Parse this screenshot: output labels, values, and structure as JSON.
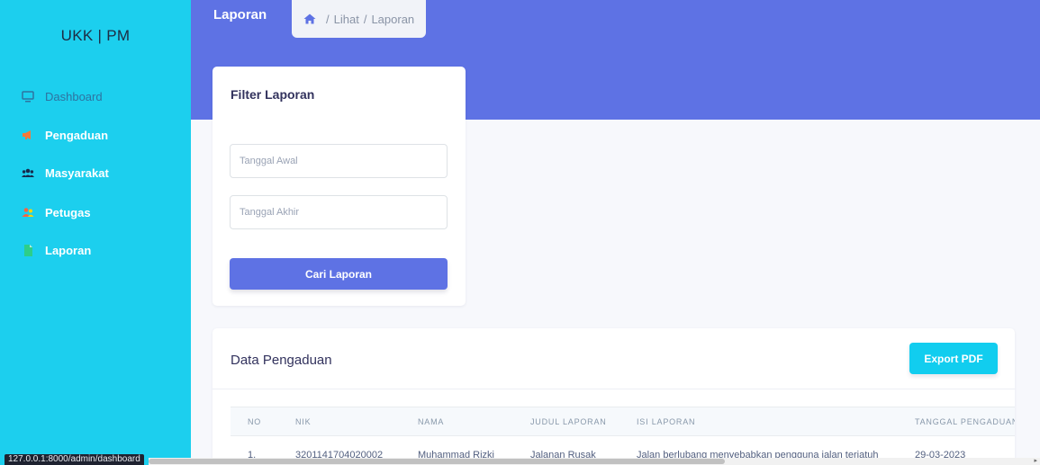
{
  "brand": "UKK | PM",
  "sidebar": {
    "items": [
      {
        "label": "Dashboard",
        "icon": "monitor-icon"
      },
      {
        "label": "Pengaduan",
        "icon": "megaphone-icon"
      },
      {
        "label": "Masyarakat",
        "icon": "users-icon"
      },
      {
        "label": "Petugas",
        "icon": "user-group-icon"
      },
      {
        "label": "Laporan",
        "icon": "file-icon"
      }
    ]
  },
  "header": {
    "title": "Laporan",
    "breadcrumb": {
      "home_icon": "home-icon",
      "sep1": "/",
      "item1": "Lihat",
      "sep2": "/",
      "item2": "Laporan"
    }
  },
  "filter": {
    "title": "Filter Laporan",
    "start_placeholder": "Tanggal Awal",
    "end_placeholder": "Tanggal Akhir",
    "button_label": "Cari Laporan"
  },
  "data": {
    "title": "Data Pengaduan",
    "export_label": "Export PDF",
    "columns": [
      "NO",
      "NIK",
      "NAMA",
      "JUDUL LAPORAN",
      "ISI LAPORAN",
      "TANGGAL PENGADUAN"
    ],
    "rows": [
      {
        "no": "1.",
        "nik": "3201141704020002",
        "nama": "Muhammad Rizki",
        "judul": "Jalanan Rusak",
        "isi": "Jalan berlubang menyebabkan pengguna jalan terjatuh",
        "tanggal": "29-03-2023"
      }
    ]
  },
  "status_url": "127.0.0.1:8000/admin/dashboard",
  "colors": {
    "sidebar": "#1ccfee",
    "header": "#5e72e4",
    "primary": "#5e72e4",
    "info": "#11cdef"
  }
}
